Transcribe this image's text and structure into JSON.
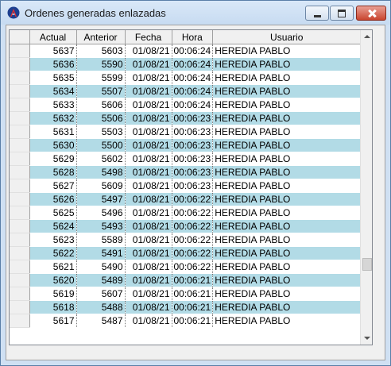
{
  "window": {
    "title": "Ordenes generadas enlazadas"
  },
  "table": {
    "columns": [
      "Actual",
      "Anterior",
      "Fecha",
      "Hora",
      "Usuario"
    ],
    "rows": [
      [
        "5637",
        "5603",
        "01/08/21",
        "00:06:24",
        "HEREDIA PABLO"
      ],
      [
        "5636",
        "5590",
        "01/08/21",
        "00:06:24",
        "HEREDIA PABLO"
      ],
      [
        "5635",
        "5599",
        "01/08/21",
        "00:06:24",
        "HEREDIA PABLO"
      ],
      [
        "5634",
        "5507",
        "01/08/21",
        "00:06:24",
        "HEREDIA PABLO"
      ],
      [
        "5633",
        "5606",
        "01/08/21",
        "00:06:24",
        "HEREDIA PABLO"
      ],
      [
        "5632",
        "5506",
        "01/08/21",
        "00:06:23",
        "HEREDIA PABLO"
      ],
      [
        "5631",
        "5503",
        "01/08/21",
        "00:06:23",
        "HEREDIA PABLO"
      ],
      [
        "5630",
        "5500",
        "01/08/21",
        "00:06:23",
        "HEREDIA PABLO"
      ],
      [
        "5629",
        "5602",
        "01/08/21",
        "00:06:23",
        "HEREDIA PABLO"
      ],
      [
        "5628",
        "5498",
        "01/08/21",
        "00:06:23",
        "HEREDIA PABLO"
      ],
      [
        "5627",
        "5609",
        "01/08/21",
        "00:06:23",
        "HEREDIA PABLO"
      ],
      [
        "5626",
        "5497",
        "01/08/21",
        "00:06:22",
        "HEREDIA PABLO"
      ],
      [
        "5625",
        "5496",
        "01/08/21",
        "00:06:22",
        "HEREDIA PABLO"
      ],
      [
        "5624",
        "5493",
        "01/08/21",
        "00:06:22",
        "HEREDIA PABLO"
      ],
      [
        "5623",
        "5589",
        "01/08/21",
        "00:06:22",
        "HEREDIA PABLO"
      ],
      [
        "5622",
        "5491",
        "01/08/21",
        "00:06:22",
        "HEREDIA PABLO"
      ],
      [
        "5621",
        "5490",
        "01/08/21",
        "00:06:22",
        "HEREDIA PABLO"
      ],
      [
        "5620",
        "5489",
        "01/08/21",
        "00:06:21",
        "HEREDIA PABLO"
      ],
      [
        "5619",
        "5607",
        "01/08/21",
        "00:06:21",
        "HEREDIA PABLO"
      ],
      [
        "5618",
        "5488",
        "01/08/21",
        "00:06:21",
        "HEREDIA PABLO"
      ],
      [
        "5617",
        "5487",
        "01/08/21",
        "00:06:21",
        "HEREDIA PABLO"
      ]
    ],
    "alt_row_color": "#b2dbe6"
  }
}
